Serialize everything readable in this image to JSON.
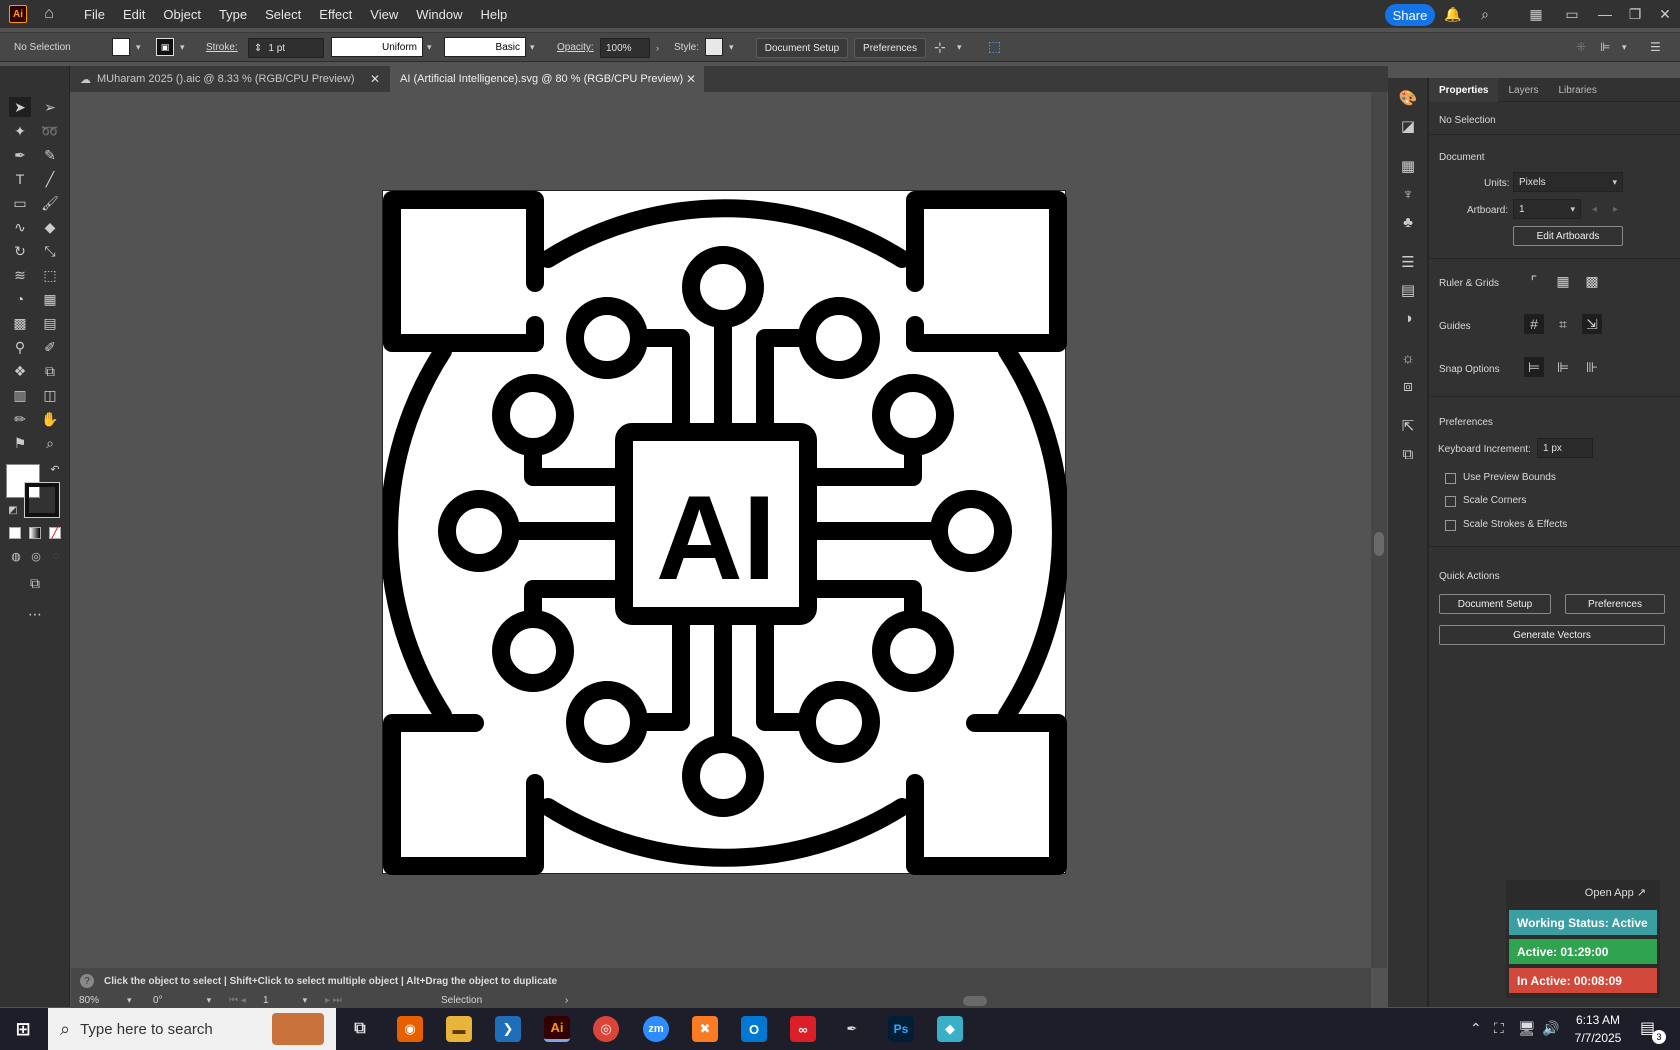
{
  "app": {
    "logo": "Ai",
    "menus": [
      "File",
      "Edit",
      "Object",
      "Type",
      "Select",
      "Effect",
      "View",
      "Window",
      "Help"
    ],
    "share": "Share"
  },
  "control": {
    "selection": "No Selection",
    "stroke_label": "Stroke:",
    "stroke_value": "1 pt",
    "profile": "Uniform",
    "brush": "Basic",
    "opacity_label": "Opacity:",
    "opacity_value": "100%",
    "style_label": "Style:",
    "doc_setup": "Document Setup",
    "preferences": "Preferences"
  },
  "tabs": [
    {
      "label": "MUharam 2025 ().aic @ 8.33 % (RGB/CPU Preview)"
    },
    {
      "label": "AI (Artificial Intelligence).svg @ 80 % (RGB/CPU Preview)"
    }
  ],
  "artwork": {
    "text": "AI"
  },
  "status": {
    "hint": "Click the object to select  |  Shift+Click to select multiple object  |  Alt+Drag the object to duplicate",
    "zoom": "80%",
    "angle": "0°",
    "artboard": "1",
    "tool": "Selection"
  },
  "properties": {
    "tabs": [
      "Properties",
      "Layers",
      "Libraries"
    ],
    "selection": "No Selection",
    "document": "Document",
    "units_label": "Units:",
    "units": "Pixels",
    "artboard_label": "Artboard:",
    "artboard": "1",
    "edit_artboards": "Edit Artboards",
    "ruler": "Ruler & Grids",
    "guides": "Guides",
    "snap": "Snap Options",
    "preferences": "Preferences",
    "kb_label": "Keyboard Increment:",
    "kb_value": "1 px",
    "cb1": "Use Preview Bounds",
    "cb2": "Scale Corners",
    "cb3": "Scale Strokes & Effects",
    "quick": "Quick Actions",
    "qa_doc": "Document Setup",
    "qa_pref": "Preferences",
    "qa_gen": "Generate Vectors"
  },
  "widget": {
    "open": "Open App ↗",
    "working": "Working Status: Active",
    "active": "Active: 01:29:00",
    "inactive": "In Active: 00:08:09"
  },
  "taskbar": {
    "search": "Type here to search",
    "time": "6:13 AM",
    "date": "7/7/2025",
    "notif": "3"
  },
  "colors": {
    "accent": "#1473e6",
    "working": "#3a9ea3",
    "active": "#2fa34f",
    "inactive": "#d2493b"
  }
}
